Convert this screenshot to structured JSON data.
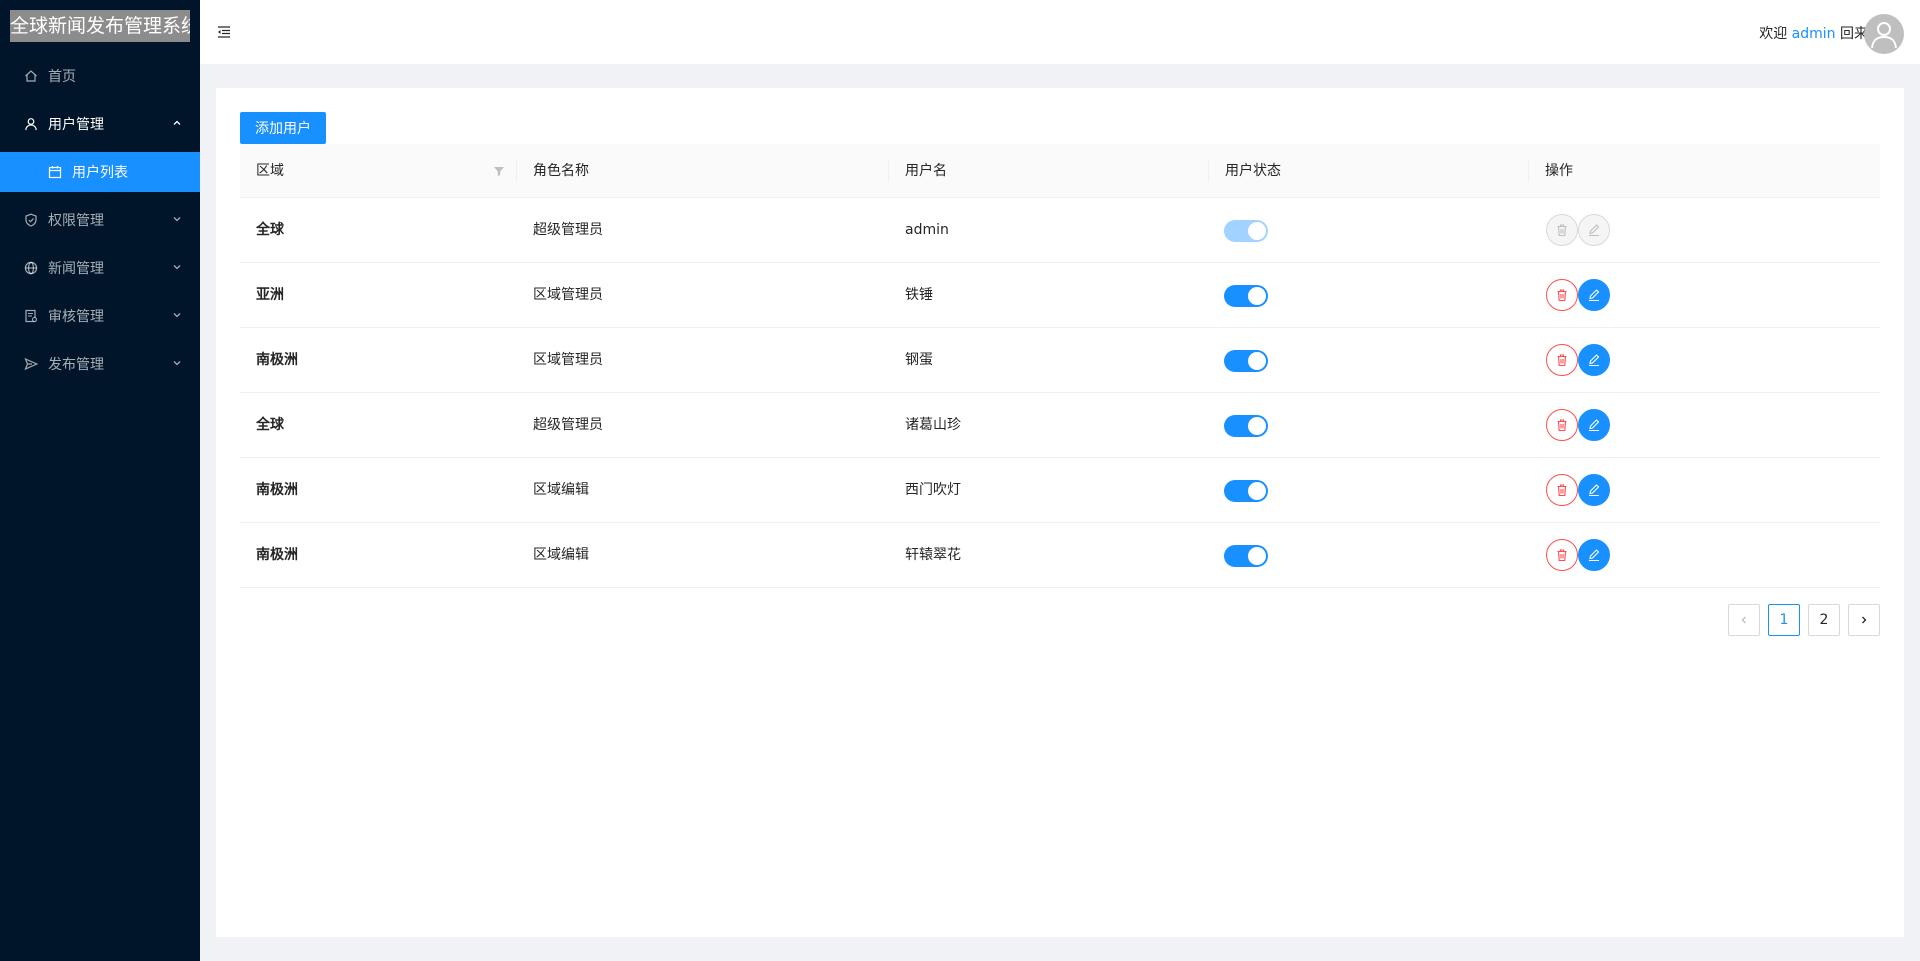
{
  "app": {
    "title": "全球新闻发布管理系统"
  },
  "sidebar": {
    "items": [
      {
        "label": "首页",
        "icon": "home-icon"
      },
      {
        "label": "用户管理",
        "icon": "user-icon",
        "expanded": true,
        "children": [
          {
            "label": "用户列表",
            "icon": "calendar-icon",
            "selected": true
          }
        ]
      },
      {
        "label": "权限管理",
        "icon": "shield-icon"
      },
      {
        "label": "新闻管理",
        "icon": "globe-icon"
      },
      {
        "label": "审核管理",
        "icon": "audit-icon"
      },
      {
        "label": "发布管理",
        "icon": "send-icon"
      }
    ]
  },
  "header": {
    "welcome_prefix": "欢迎",
    "username": "admin",
    "welcome_suffix": "回来"
  },
  "toolbar": {
    "add_label": "添加用户"
  },
  "table": {
    "columns": [
      "区域",
      "角色名称",
      "用户名",
      "用户状态",
      "操作"
    ],
    "rows": [
      {
        "region": "全球",
        "role": "超级管理员",
        "username": "admin",
        "status": true,
        "disabled": true
      },
      {
        "region": "亚洲",
        "role": "区域管理员",
        "username": "铁锤",
        "status": true,
        "disabled": false
      },
      {
        "region": "南极洲",
        "role": "区域管理员",
        "username": "钢蛋",
        "status": true,
        "disabled": false
      },
      {
        "region": "全球",
        "role": "超级管理员",
        "username": "诸葛山珍",
        "status": true,
        "disabled": false
      },
      {
        "region": "南极洲",
        "role": "区域编辑",
        "username": "西门吹灯",
        "status": true,
        "disabled": false
      },
      {
        "region": "南极洲",
        "role": "区域编辑",
        "username": "轩辕翠花",
        "status": true,
        "disabled": false
      }
    ]
  },
  "pagination": {
    "pages": [
      "1",
      "2"
    ],
    "current": "1",
    "prev_icon": "chevron-left-icon",
    "next_icon": "chevron-right-icon"
  },
  "colors": {
    "primary": "#1890ff",
    "danger": "#ff4d4f",
    "sidebar_bg": "#001529"
  }
}
